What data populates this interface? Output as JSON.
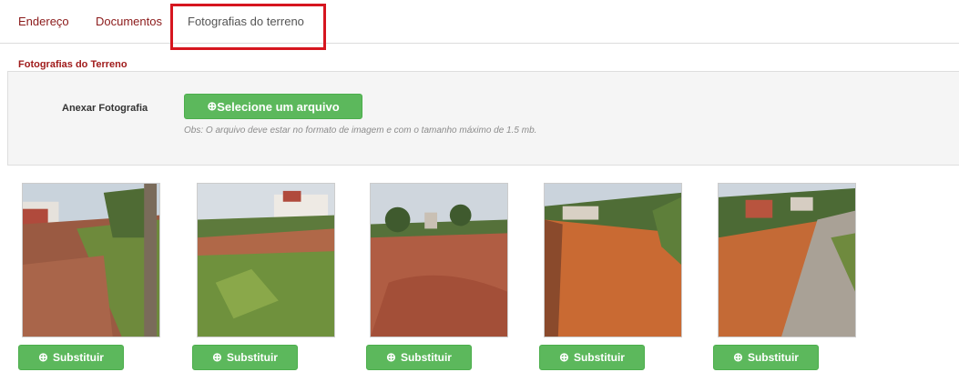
{
  "tabs": [
    {
      "label": "Endereço"
    },
    {
      "label": "Documentos"
    },
    {
      "label": "Fotografias do terreno"
    }
  ],
  "section": {
    "legend": "Fotografias do Terreno",
    "field_label": "Anexar Fotografia",
    "file_button_label": "Selecione um arquivo",
    "file_button_icon": "upload-icon",
    "hint": "Obs: O arquivo deve estar no formato de imagem e com o tamanho máximo de 1.5 mb."
  },
  "photos": [
    {
      "button_label": "Substituir"
    },
    {
      "button_label": "Substituir"
    },
    {
      "button_label": "Substituir"
    },
    {
      "button_label": "Substituir"
    },
    {
      "button_label": "Substituir"
    }
  ],
  "colors": {
    "accent_red": "#a01c1c",
    "highlight_red": "#d6161f",
    "button_green": "#5cb85c"
  }
}
